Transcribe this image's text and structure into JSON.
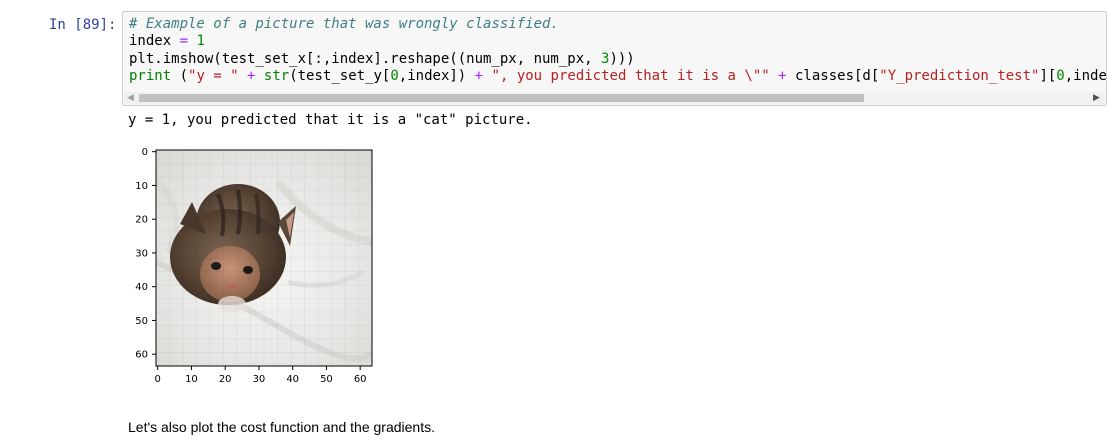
{
  "cell": {
    "prompt": "In [89]:",
    "code_lines": [
      [
        {
          "t": "# Example of a picture that was wrongly classified.",
          "c": "cm-comment"
        }
      ],
      [
        {
          "t": "index ",
          "c": "cm-var"
        },
        {
          "t": "=",
          "c": "cm-operator"
        },
        {
          "t": " ",
          "c": "cm-var"
        },
        {
          "t": "1",
          "c": "cm-number"
        }
      ],
      [
        {
          "t": "plt.imshow(test_set_x[:,index].reshape((num_px, num_px, ",
          "c": "cm-var"
        },
        {
          "t": "3",
          "c": "cm-number"
        },
        {
          "t": ")))",
          "c": "cm-var"
        }
      ],
      [
        {
          "t": "print",
          "c": "cm-keyword"
        },
        {
          "t": " (",
          "c": "cm-var"
        },
        {
          "t": "\"y = \"",
          "c": "cm-string"
        },
        {
          "t": " ",
          "c": "cm-var"
        },
        {
          "t": "+",
          "c": "cm-operator"
        },
        {
          "t": " ",
          "c": "cm-var"
        },
        {
          "t": "str",
          "c": "cm-builtin"
        },
        {
          "t": "(test_set_y[",
          "c": "cm-var"
        },
        {
          "t": "0",
          "c": "cm-number"
        },
        {
          "t": ",index]) ",
          "c": "cm-var"
        },
        {
          "t": "+",
          "c": "cm-operator"
        },
        {
          "t": " ",
          "c": "cm-var"
        },
        {
          "t": "\", you predicted that it is a \\\"\"",
          "c": "cm-string"
        },
        {
          "t": " ",
          "c": "cm-var"
        },
        {
          "t": "+",
          "c": "cm-operator"
        },
        {
          "t": " classes[d[",
          "c": "cm-var"
        },
        {
          "t": "\"Y_prediction_test\"",
          "c": "cm-string"
        },
        {
          "t": "][",
          "c": "cm-var"
        },
        {
          "t": "0",
          "c": "cm-number"
        },
        {
          "t": ",inde",
          "c": "cm-var"
        }
      ]
    ],
    "output_text": "y = 1, you predicted that it is a \"cat\" picture."
  },
  "chart_data": {
    "type": "image",
    "image_subject": "cat",
    "xticks": [
      "0",
      "10",
      "20",
      "30",
      "40",
      "50",
      "60"
    ],
    "yticks": [
      "0",
      "10",
      "20",
      "30",
      "40",
      "50",
      "60"
    ],
    "xlim": [
      -0.5,
      63.5
    ],
    "ylim": [
      63.5,
      -0.5
    ]
  },
  "markdown": {
    "text": "Let's also plot the cost function and the gradients."
  },
  "colors": {
    "prompt": "#303F9F",
    "comment": "#408080",
    "string": "#BA2121",
    "keyword": "#008000",
    "operator": "#AA22FF"
  }
}
